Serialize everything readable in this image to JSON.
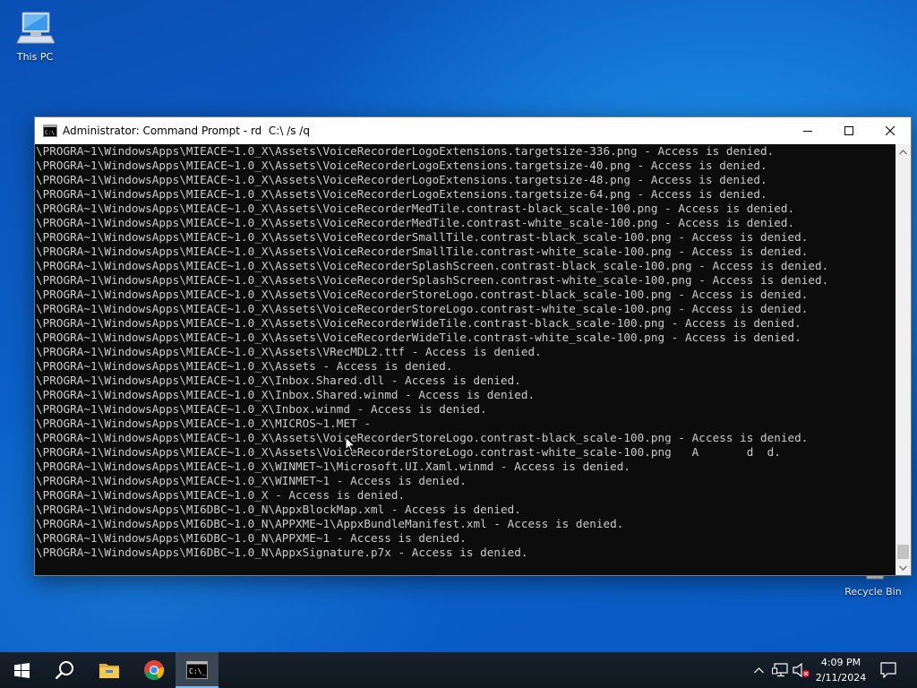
{
  "desktop": {
    "icons": [
      {
        "label": "This PC",
        "icon": "this-pc-icon"
      },
      {
        "label": "Recycle Bin",
        "icon": "recycle-bin-icon"
      }
    ]
  },
  "window": {
    "title": "Administrator: Command Prompt - rd  C:\\ /s /q",
    "app_icon": "cmd-icon",
    "buttons": {
      "minimize": "minimize-icon",
      "maximize": "maximize-icon",
      "close": "close-icon"
    }
  },
  "console": {
    "lines": [
      "\\PROGRA~1\\WindowsApps\\MIEACE~1.0_X\\Assets\\VoiceRecorderLogoExtensions.targetsize-336.png - Access is denied.",
      "\\PROGRA~1\\WindowsApps\\MIEACE~1.0_X\\Assets\\VoiceRecorderLogoExtensions.targetsize-40.png - Access is denied.",
      "\\PROGRA~1\\WindowsApps\\MIEACE~1.0_X\\Assets\\VoiceRecorderLogoExtensions.targetsize-48.png - Access is denied.",
      "\\PROGRA~1\\WindowsApps\\MIEACE~1.0_X\\Assets\\VoiceRecorderLogoExtensions.targetsize-64.png - Access is denied.",
      "\\PROGRA~1\\WindowsApps\\MIEACE~1.0_X\\Assets\\VoiceRecorderMedTile.contrast-black_scale-100.png - Access is denied.",
      "\\PROGRA~1\\WindowsApps\\MIEACE~1.0_X\\Assets\\VoiceRecorderMedTile.contrast-white_scale-100.png - Access is denied.",
      "\\PROGRA~1\\WindowsApps\\MIEACE~1.0_X\\Assets\\VoiceRecorderSmallTile.contrast-black_scale-100.png - Access is denied.",
      "\\PROGRA~1\\WindowsApps\\MIEACE~1.0_X\\Assets\\VoiceRecorderSmallTile.contrast-white_scale-100.png - Access is denied.",
      "\\PROGRA~1\\WindowsApps\\MIEACE~1.0_X\\Assets\\VoiceRecorderSplashScreen.contrast-black_scale-100.png - Access is denied.",
      "\\PROGRA~1\\WindowsApps\\MIEACE~1.0_X\\Assets\\VoiceRecorderSplashScreen.contrast-white_scale-100.png - Access is denied.",
      "\\PROGRA~1\\WindowsApps\\MIEACE~1.0_X\\Assets\\VoiceRecorderStoreLogo.contrast-black_scale-100.png - Access is denied.",
      "\\PROGRA~1\\WindowsApps\\MIEACE~1.0_X\\Assets\\VoiceRecorderStoreLogo.contrast-white_scale-100.png - Access is denied.",
      "\\PROGRA~1\\WindowsApps\\MIEACE~1.0_X\\Assets\\VoiceRecorderWideTile.contrast-black_scale-100.png - Access is denied.",
      "\\PROGRA~1\\WindowsApps\\MIEACE~1.0_X\\Assets\\VoiceRecorderWideTile.contrast-white_scale-100.png - Access is denied.",
      "\\PROGRA~1\\WindowsApps\\MIEACE~1.0_X\\Assets\\VRecMDL2.ttf - Access is denied.",
      "\\PROGRA~1\\WindowsApps\\MIEACE~1.0_X\\Assets - Access is denied.",
      "\\PROGRA~1\\WindowsApps\\MIEACE~1.0_X\\Inbox.Shared.dll - Access is denied.",
      "\\PROGRA~1\\WindowsApps\\MIEACE~1.0_X\\Inbox.Shared.winmd - Access is denied.",
      "\\PROGRA~1\\WindowsApps\\MIEACE~1.0_X\\Inbox.winmd - Access is denied.",
      "\\PROGRA~1\\WindowsApps\\MIEACE~1.0_X\\MICROS~1.MET -",
      "\\PROGRA~1\\WindowsApps\\MIEACE~1.0_X\\Assets\\VoiceRecorderStoreLogo.contrast-black_scale-100.png - Access is denied.",
      "\\PROGRA~1\\WindowsApps\\MIEACE~1.0_X\\Assets\\VoiceRecorderStoreLogo.contrast-white_scale-100.png   A       d  d.",
      "\\PROGRA~1\\WindowsApps\\MIEACE~1.0_X\\WINMET~1\\Microsoft.UI.Xaml.winmd - Access is denied.",
      "\\PROGRA~1\\WindowsApps\\MIEACE~1.0_X\\WINMET~1 - Access is denied.",
      "\\PROGRA~1\\WindowsApps\\MIEACE~1.0_X - Access is denied.",
      "\\PROGRA~1\\WindowsApps\\MI6DBC~1.0_N\\AppxBlockMap.xml - Access is denied.",
      "\\PROGRA~1\\WindowsApps\\MI6DBC~1.0_N\\APPXME~1\\AppxBundleManifest.xml - Access is denied.",
      "\\PROGRA~1\\WindowsApps\\MI6DBC~1.0_N\\APPXME~1 - Access is denied.",
      "\\PROGRA~1\\WindowsApps\\MI6DBC~1.0_N\\AppxSignature.p7x - Access is denied."
    ]
  },
  "taskbar": {
    "items": [
      "start-icon",
      "search-icon",
      "file-explorer-icon",
      "chrome-icon",
      "command-prompt-icon"
    ],
    "tray_icons": [
      "chevron-up-icon",
      "network-icon",
      "volume-muted-icon"
    ],
    "time": "4:09 PM",
    "date": "2/11/2024",
    "notification": "notification-icon"
  },
  "colors": {
    "console_bg": "#0c0c0c",
    "console_text": "#cccccc",
    "taskbar_bg": "#101820",
    "desktop_accent": "#0b62c9"
  }
}
